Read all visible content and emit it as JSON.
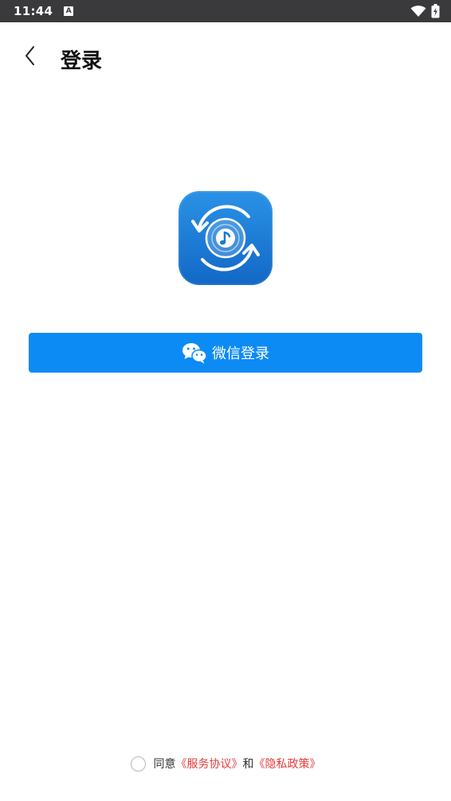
{
  "status_bar": {
    "time": "11:44",
    "notification_letter": "A",
    "icons": [
      "wifi-icon",
      "battery-charging-icon"
    ]
  },
  "header": {
    "back_icon": "chevron-left-icon",
    "title": "登录"
  },
  "logo": {
    "icon": "music-sync-app-icon",
    "colors": {
      "top": "#2a92e6",
      "bottom": "#1268c6"
    }
  },
  "login": {
    "wechat_button_label": "微信登录",
    "wechat_icon": "wechat-icon",
    "button_color": "#0d8bf5"
  },
  "agreement": {
    "prefix": "同意",
    "service_link": "《服务协议》",
    "connector": "和",
    "privacy_link": "《隐私政策》",
    "link_color": "#e23b3b"
  }
}
